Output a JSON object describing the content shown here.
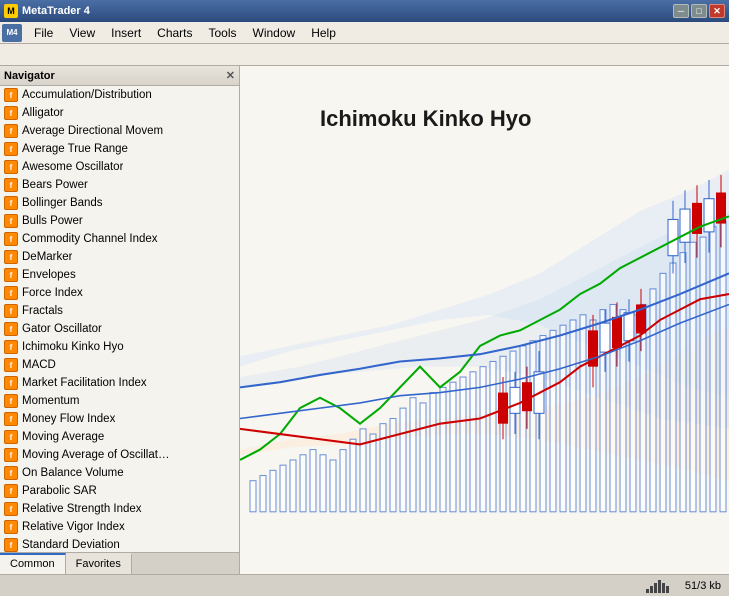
{
  "titleBar": {
    "title": "MetaTrader 4",
    "minBtn": "─",
    "maxBtn": "□",
    "closeBtn": "✕"
  },
  "menuBar": {
    "items": [
      "File",
      "View",
      "Insert",
      "Charts",
      "Tools",
      "Window",
      "Help"
    ]
  },
  "navigator": {
    "title": "Navigator",
    "indicators": [
      "Accumulation/Distribution",
      "Alligator",
      "Average Directional Movem",
      "Average True Range",
      "Awesome Oscillator",
      "Bears Power",
      "Bollinger Bands",
      "Bulls Power",
      "Commodity Channel Index",
      "DeMarker",
      "Envelopes",
      "Force Index",
      "Fractals",
      "Gator Oscillator",
      "Ichimoku Kinko Hyo",
      "MACD",
      "Market Facilitation Index",
      "Momentum",
      "Money Flow Index",
      "Moving Average",
      "Moving Average of Oscillat…",
      "On Balance Volume",
      "Parabolic SAR",
      "Relative Strength Index",
      "Relative Vigor Index",
      "Standard Deviation"
    ],
    "tabs": [
      "Common",
      "Favorites"
    ]
  },
  "chart": {
    "title": "Ichimoku Kinko Hyo"
  },
  "statusBar": {
    "barIcon": "bars",
    "info": "51/3 kb"
  }
}
